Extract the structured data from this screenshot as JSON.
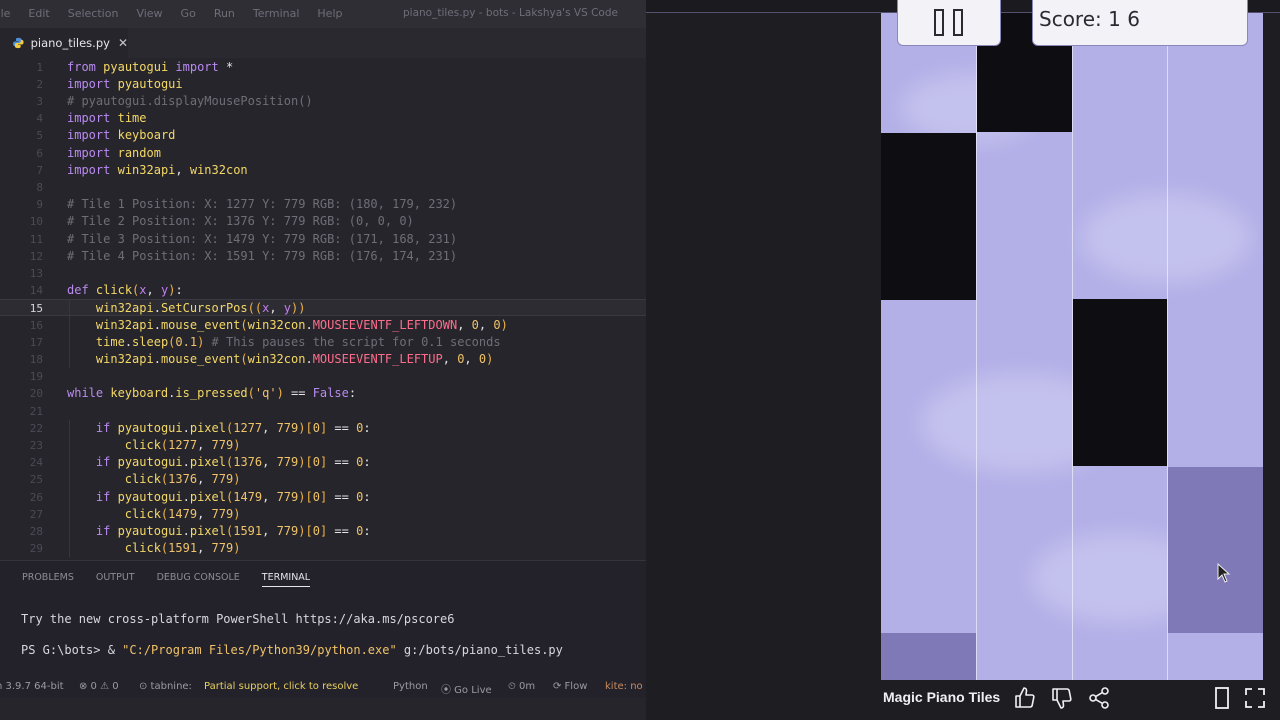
{
  "vscode": {
    "menu": [
      "File",
      "Edit",
      "Selection",
      "View",
      "Go",
      "Run",
      "Terminal",
      "Help"
    ],
    "window_title": "piano_tiles.py - bots - Lakshya's VS Code",
    "tab": {
      "label": "piano_tiles.py",
      "close": "✕"
    },
    "active_line": 15,
    "code_lines": [
      "from pyautogui import *",
      "import pyautogui",
      "# pyautogui.displayMousePosition()",
      "import time",
      "import keyboard",
      "import random",
      "import win32api, win32con",
      "",
      "# Tile 1 Position: X: 1277 Y: 779 RGB: (180, 179, 232)",
      "# Tile 2 Position: X: 1376 Y: 779 RGB: (0, 0, 0)",
      "# Tile 3 Position: X: 1479 Y: 779 RGB: (171, 168, 231)",
      "# Tile 4 Position: X: 1591 Y: 779 RGB: (176, 174, 231)",
      "",
      "def click(x, y):",
      "    win32api.SetCursorPos((x, y))",
      "    win32api.mouse_event(win32con.MOUSEEVENTF_LEFTDOWN, 0, 0)",
      "    time.sleep(0.1) # This pauses the script for 0.1 seconds",
      "    win32api.mouse_event(win32con.MOUSEEVENTF_LEFTUP, 0, 0)",
      "",
      "while keyboard.is_pressed('q') == False:",
      "",
      "    if pyautogui.pixel(1277, 779)[0] == 0:",
      "        click(1277, 779)",
      "    if pyautogui.pixel(1376, 779)[0] == 0:",
      "        click(1376, 779)",
      "    if pyautogui.pixel(1479, 779)[0] == 0:",
      "        click(1479, 779)",
      "    if pyautogui.pixel(1591, 779)[0] == 0:",
      "        click(1591, 779)"
    ],
    "panel": {
      "tabs": [
        "PROBLEMS",
        "OUTPUT",
        "DEBUG CONSOLE",
        "TERMINAL"
      ],
      "active_tab": "TERMINAL",
      "line1": "Try the new cross-platform PowerShell https://aka.ms/pscore6",
      "prompt": "PS G:\\bots> & ",
      "python_path": "\"C:/Program Files/Python39/python.exe\"",
      "script": " g:/bots/piano_tiles.py"
    },
    "status": {
      "python": "n 3.9.7 64-bit",
      "problems": "⊗ 0 ⚠ 0",
      "tabnine": "⊙ tabnine:",
      "partial": "Partial support, click to resolve",
      "lang": "Python",
      "golive": "⦿ Go Live",
      "time": "⏲ 0m",
      "flow": "⟳ Flow",
      "kite": "kite: no"
    }
  },
  "game": {
    "score_label": "Score: 1 6",
    "title": "Magic Piano Tiles",
    "colors": {
      "tile_black": "#0e0d12",
      "tile_pressed": "#7f7ab7",
      "board_bg": "#b3b0e8"
    },
    "icons": [
      "thumbs-up-icon",
      "thumbs-down-icon",
      "share-icon",
      "phone-frame-icon",
      "fullscreen-icon"
    ]
  }
}
